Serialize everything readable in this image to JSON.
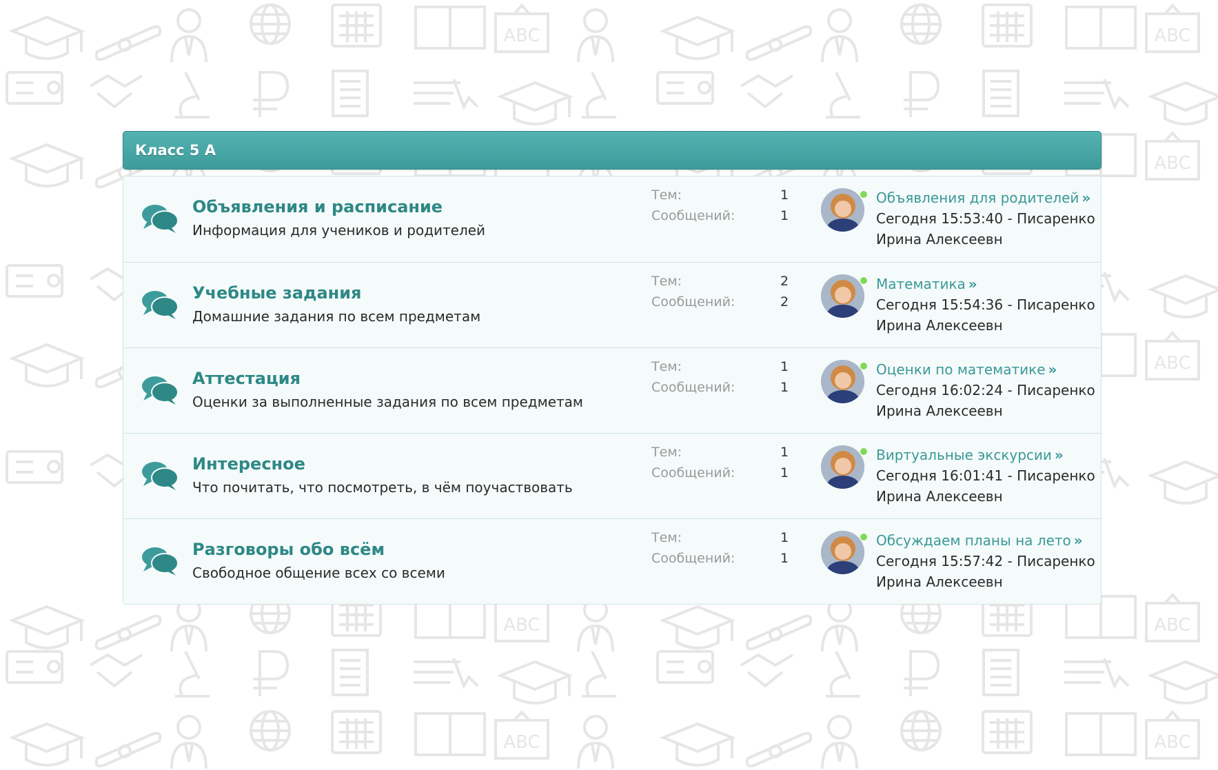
{
  "category": {
    "title": "Класс 5 А"
  },
  "stat_labels": {
    "topics": "Тем:",
    "messages": "Сообщений:"
  },
  "colors": {
    "accent": "#3d9c9b",
    "link": "#2e8886",
    "background_icons": "#ececec"
  },
  "icons": {
    "node": "speech-bubbles-icon",
    "background": [
      "graduation-cap-icon",
      "diploma-scroll-icon",
      "teacher-icon",
      "globe-icon",
      "calculator-icon",
      "open-book-icon",
      "abc-board-icon",
      "id-card-icon",
      "handshake-icon",
      "microscope-icon",
      "ruble-icon",
      "document-icon",
      "cursor-icon"
    ]
  },
  "nodes": [
    {
      "title": "Объявления и расписание",
      "description": "Информация для учеников и родителей",
      "topics": "1",
      "messages": "1",
      "last_thread": "Объявления для родителей",
      "last_meta_1": "Сегодня 15:53:40 - Писаренко",
      "last_meta_2": "Ирина Алексеевн"
    },
    {
      "title": "Учебные задания",
      "description": "Домашние задания по всем предметам",
      "topics": "2",
      "messages": "2",
      "last_thread": "Математика",
      "last_meta_1": "Сегодня 15:54:36 - Писаренко",
      "last_meta_2": "Ирина Алексеевн"
    },
    {
      "title": "Аттестация",
      "description": "Оценки за выполненные задания по всем предметам",
      "topics": "1",
      "messages": "1",
      "last_thread": "Оценки по математике",
      "last_meta_1": "Сегодня 16:02:24 - Писаренко",
      "last_meta_2": "Ирина Алексеевн"
    },
    {
      "title": "Интересное",
      "description": "Что почитать, что посмотреть, в чём поучаствовать",
      "topics": "1",
      "messages": "1",
      "last_thread": "Виртуальные экскурсии",
      "last_meta_1": "Сегодня 16:01:41 - Писаренко",
      "last_meta_2": "Ирина Алексеевн"
    },
    {
      "title": "Разговоры обо всём",
      "description": "Свободное общение всех со всеми",
      "topics": "1",
      "messages": "1",
      "last_thread": "Обсуждаем планы на лето",
      "last_meta_1": "Сегодня 15:57:42 - Писаренко",
      "last_meta_2": "Ирина Алексеевн"
    }
  ],
  "arrow_glyph": "»"
}
